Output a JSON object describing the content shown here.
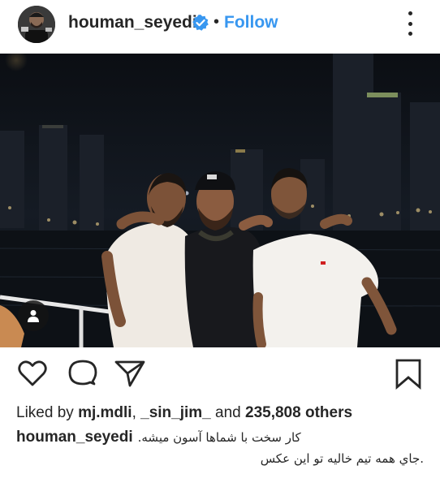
{
  "post": {
    "username": "houman_seyedi",
    "separator": "•",
    "follow_label": "Follow",
    "likes": {
      "prefix": "Liked by",
      "user1": "mj.mdli",
      "comma": ",",
      "user2": "_sin_jim_",
      "and": "and",
      "others": "235,808 others"
    },
    "caption": {
      "username": "houman_seyedi",
      "line1": ".کار سخت با شماها آسون میشه",
      "line2": "جاي همه تیم خالیه تو این عکس."
    }
  },
  "icons": {
    "verified": "verified-badge-icon",
    "more": "more-options-icon",
    "like": "heart-icon",
    "comment": "comment-icon",
    "share": "paper-plane-icon",
    "save": "bookmark-icon",
    "tag": "user-tag-icon"
  },
  "colors": {
    "accent": "#3897f0",
    "text": "#262626",
    "background": "#ffffff"
  }
}
